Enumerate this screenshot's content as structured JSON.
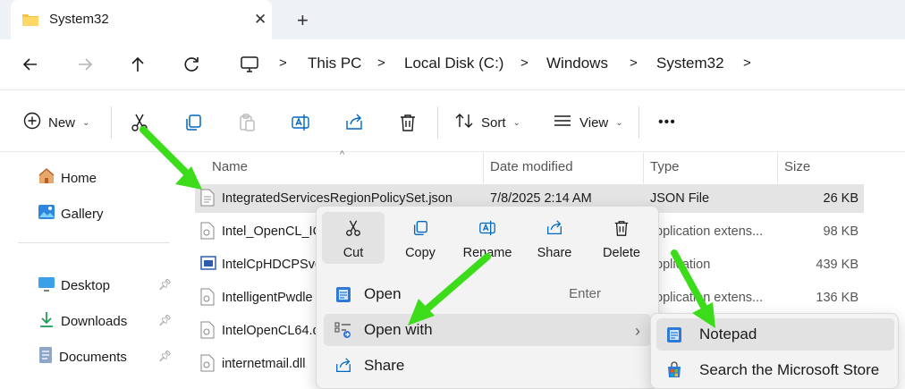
{
  "tab": {
    "title": "System32",
    "close": "✕",
    "new": "+"
  },
  "nav": {
    "crumbs": [
      "This PC",
      "Local Disk (C:)",
      "Windows",
      "System32"
    ]
  },
  "toolbar": {
    "new_label": "New",
    "sort_label": "Sort",
    "view_label": "View",
    "more_label": "•••"
  },
  "sidebar": {
    "items": [
      {
        "label": "Home",
        "icon": "home-icon"
      },
      {
        "label": "Gallery",
        "icon": "gallery-icon"
      },
      {
        "label": "Desktop",
        "icon": "desktop-icon",
        "pinned": true
      },
      {
        "label": "Downloads",
        "icon": "downloads-icon",
        "pinned": true
      },
      {
        "label": "Documents",
        "icon": "documents-icon",
        "pinned": true
      }
    ]
  },
  "columns": {
    "name": "Name",
    "date": "Date modified",
    "type": "Type",
    "size": "Size"
  },
  "files": [
    {
      "name": "IntegratedServicesRegionPolicySet.json",
      "date": "7/8/2025 2:14 AM",
      "type": "JSON File",
      "size": "26 KB"
    },
    {
      "name": "Intel_OpenCL_IC",
      "date": "",
      "type": "pplication extens...",
      "size": "98 KB"
    },
    {
      "name": "IntelCpHDCPSvc",
      "date": "",
      "type": "pplication",
      "size": "439 KB"
    },
    {
      "name": "IntelligentPwdle",
      "date": "",
      "type": "pplication extens...",
      "size": "136 KB"
    },
    {
      "name": "IntelOpenCL64.d",
      "date": "",
      "type": "",
      "size": ""
    },
    {
      "name": "internetmail.dll",
      "date": "",
      "type": "",
      "size": ""
    }
  ],
  "context_menu": {
    "quick_actions": [
      "Cut",
      "Copy",
      "Rename",
      "Share",
      "Delete"
    ],
    "items": [
      {
        "label": "Open",
        "accel": "Enter"
      },
      {
        "label": "Open with",
        "accel": "›"
      },
      {
        "label": "Share",
        "accel": ""
      }
    ]
  },
  "submenu": {
    "items": [
      "Notepad",
      "Search the Microsoft Store"
    ]
  },
  "colors": {
    "accent": "#0067c0",
    "arrow": "#3ddc1b",
    "folder": "#f4c542",
    "selection": "#e4e4e4"
  }
}
